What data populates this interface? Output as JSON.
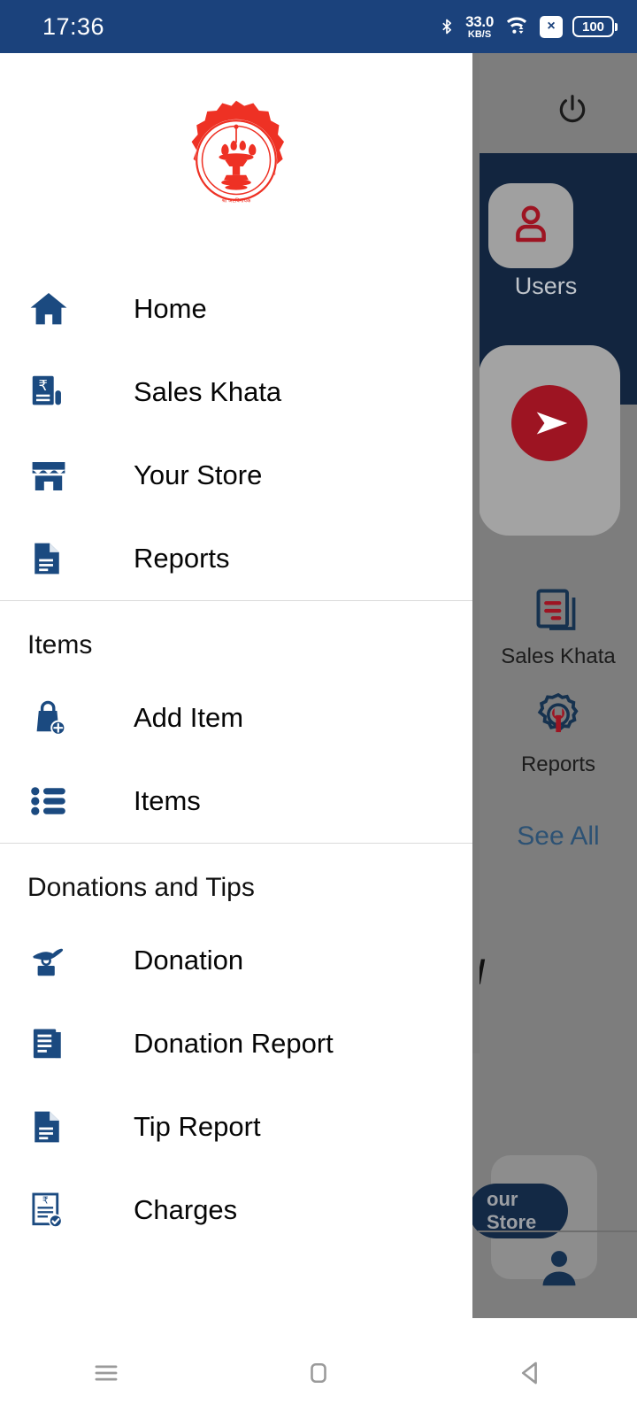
{
  "statusbar": {
    "clock": "17:36",
    "bluetooth_icon": "bluetooth-icon",
    "network_speed_value": "33.0",
    "network_speed_unit": "KB/S",
    "wifi_icon": "wifi-icon",
    "sim_icon_label": "×",
    "battery_level": "100",
    "background_color": "#1b427c"
  },
  "drawer": {
    "logo_name": "company-gear-lamp-logo",
    "accent_blue": "#1b4a80",
    "logo_red": "#ee3124",
    "sections": [
      {
        "title": null,
        "items": [
          {
            "label": "Home",
            "icon": "home-icon"
          },
          {
            "label": "Sales Khata",
            "icon": "rupee-receipt-icon"
          },
          {
            "label": "Your Store",
            "icon": "store-icon"
          },
          {
            "label": "Reports",
            "icon": "document-report-icon"
          }
        ]
      },
      {
        "title": "Items",
        "items": [
          {
            "label": "Add Item",
            "icon": "bag-plus-icon"
          },
          {
            "label": "Items",
            "icon": "bullet-list-icon"
          }
        ]
      },
      {
        "title": "Donations and Tips",
        "items": [
          {
            "label": "Donation",
            "icon": "hand-coin-donation-icon"
          },
          {
            "label": "Donation Report",
            "icon": "document-stack-icon"
          },
          {
            "label": "Tip Report",
            "icon": "document-icon"
          },
          {
            "label": "Charges",
            "icon": "invoice-check-icon"
          }
        ]
      }
    ]
  },
  "background_app": {
    "power_icon": "power-icon",
    "navy_color": "#12253f",
    "red_color": "#9d1422",
    "user_tile_label": "Users",
    "send_icon": "send-arrow-icon",
    "tiles": [
      {
        "label": "Sales Khata",
        "icon": "sales-khata-icon"
      },
      {
        "label": "Reports",
        "icon": "gear-wrench-icon"
      }
    ],
    "see_all_label": "See All",
    "partial_text": "/",
    "store_pill_label": "our Store",
    "profile_icon": "person-icon"
  },
  "navbar": {
    "recents_label": "recent-apps",
    "home_label": "home",
    "back_label": "back"
  }
}
